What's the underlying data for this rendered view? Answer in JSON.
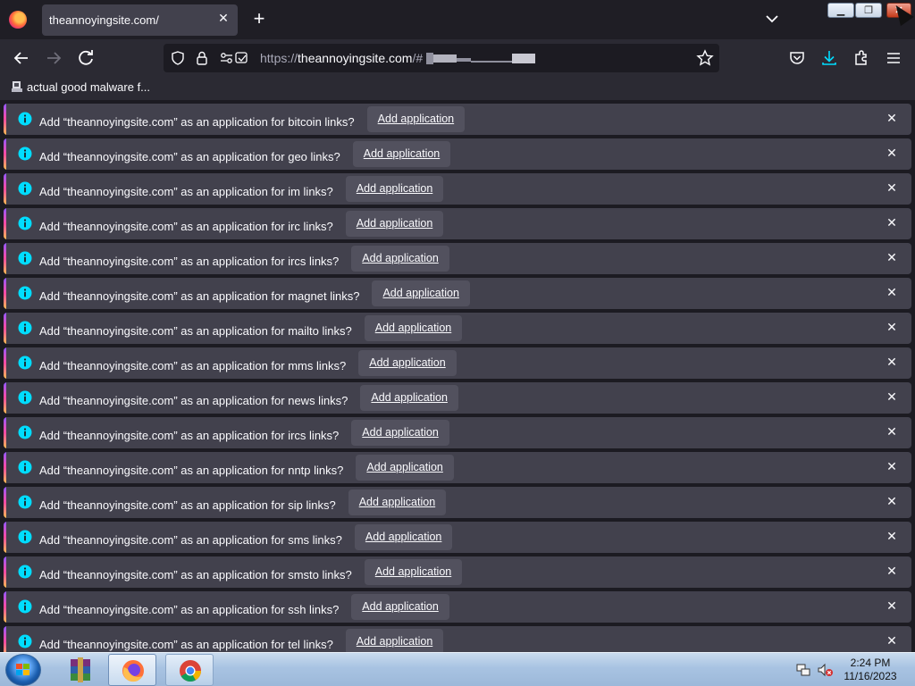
{
  "tab": {
    "title": "theannoyingsite.com/",
    "close": "✕"
  },
  "navbar": {
    "url_prefix": "https://",
    "url_host": "theannoyingsite.com",
    "url_suffix": "/#"
  },
  "bookmarks": {
    "item_label": "actual good malware f..."
  },
  "notification": {
    "close": "✕",
    "button_label": "Add application",
    "items": [
      {
        "text": "Add “theannoyingsite.com” as an application for bitcoin links?"
      },
      {
        "text": "Add “theannoyingsite.com” as an application for geo links?"
      },
      {
        "text": "Add “theannoyingsite.com” as an application for im links?"
      },
      {
        "text": "Add “theannoyingsite.com” as an application for irc links?"
      },
      {
        "text": "Add “theannoyingsite.com” as an application for ircs links?"
      },
      {
        "text": "Add “theannoyingsite.com” as an application for magnet links?"
      },
      {
        "text": "Add “theannoyingsite.com” as an application for mailto links?"
      },
      {
        "text": "Add “theannoyingsite.com” as an application for mms links?"
      },
      {
        "text": "Add “theannoyingsite.com” as an application for news links?"
      },
      {
        "text": "Add “theannoyingsite.com” as an application for ircs links?"
      },
      {
        "text": "Add “theannoyingsite.com” as an application for nntp links?"
      },
      {
        "text": "Add “theannoyingsite.com” as an application for sip links?"
      },
      {
        "text": "Add “theannoyingsite.com” as an application for sms links?"
      },
      {
        "text": "Add “theannoyingsite.com” as an application for smsto links?"
      },
      {
        "text": "Add “theannoyingsite.com” as an application for ssh links?"
      },
      {
        "text": "Add “theannoyingsite.com” as an application for tel links?"
      }
    ]
  },
  "taskbar": {
    "time": "2:24 PM",
    "date": "11/16/2023"
  },
  "colors": {
    "accent_info": "#00ddff",
    "bar_bg": "#42414d",
    "page_bg": "#1c1b22",
    "taskbar": "#a8c3e2"
  }
}
